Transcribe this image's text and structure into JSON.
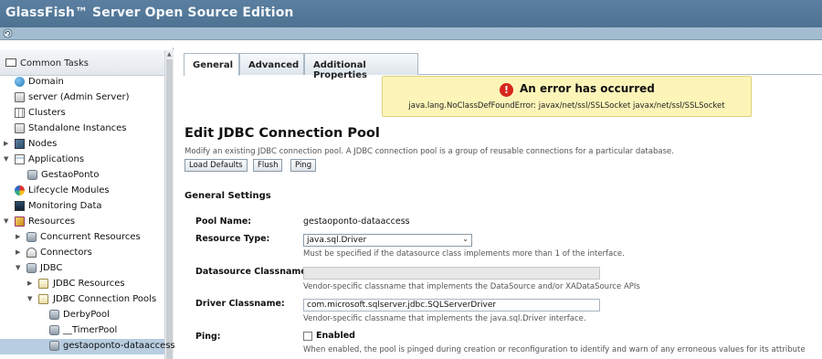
{
  "app": {
    "title": "GlassFish™ Server Open Source Edition"
  },
  "tree": {
    "header": "Common Tasks",
    "items": [
      {
        "label": "Domain",
        "icon": "globe-icon"
      },
      {
        "label": "server (Admin Server)",
        "icon": "server-icon"
      },
      {
        "label": "Clusters",
        "icon": "cluster-icon"
      },
      {
        "label": "Standalone Instances",
        "icon": "server-icon"
      },
      {
        "label": "Nodes",
        "icon": "node-icon"
      },
      {
        "label": "Applications",
        "icon": "application-icon"
      },
      {
        "label": "GestaoPonto",
        "icon": "database-icon"
      },
      {
        "label": "Lifecycle Modules",
        "icon": "lifecycle-icon"
      },
      {
        "label": "Monitoring Data",
        "icon": "monitor-icon"
      },
      {
        "label": "Resources",
        "icon": "resources-icon"
      },
      {
        "label": "Concurrent Resources",
        "icon": "database-icon"
      },
      {
        "label": "Connectors",
        "icon": "connector-icon"
      },
      {
        "label": "JDBC",
        "icon": "database-icon"
      },
      {
        "label": "JDBC Resources",
        "icon": "folder-icon"
      },
      {
        "label": "JDBC Connection Pools",
        "icon": "folder-icon"
      },
      {
        "label": "DerbyPool",
        "icon": "database-icon"
      },
      {
        "label": "__TimerPool",
        "icon": "database-icon"
      },
      {
        "label": "gestaoponto-dataaccess",
        "icon": "database-icon"
      }
    ]
  },
  "tabs": [
    "General",
    "Advanced",
    "Additional Properties"
  ],
  "error": {
    "heading": "An error has occurred",
    "message": "java.lang.NoClassDefFoundError: javax/net/ssl/SSLSocket javax/net/ssl/SSLSocket"
  },
  "page": {
    "title": "Edit JDBC Connection Pool",
    "description": "Modify an existing JDBC connection pool. A JDBC connection pool is a group of reusable connections for a particular database.",
    "buttons": {
      "load_defaults": "Load Defaults",
      "flush": "Flush",
      "ping": "Ping"
    },
    "section": "General Settings"
  },
  "form": {
    "pool_name": {
      "label": "Pool Name:",
      "value": "gestaoponto-dataaccess"
    },
    "resource_type": {
      "label": "Resource Type:",
      "value": "java.sql.Driver",
      "help": "Must be specified if the datasource class implements more than 1 of the interface."
    },
    "datasource_classname": {
      "label": "Datasource Classname:",
      "value": "",
      "help": "Vendor-specific classname that implements the DataSource and/or XADataSource APIs"
    },
    "driver_classname": {
      "label": "Driver Classname:",
      "value": "com.microsoft.sqlserver.jdbc.SQLServerDriver",
      "help": "Vendor-specific classname that implements the java.sql.Driver interface."
    },
    "ping": {
      "label": "Ping:",
      "checkbox_label": "Enabled",
      "help": "When enabled, the pool is pinged during creation or reconfiguration to identify and warn of any erroneous values for its attribute"
    }
  }
}
